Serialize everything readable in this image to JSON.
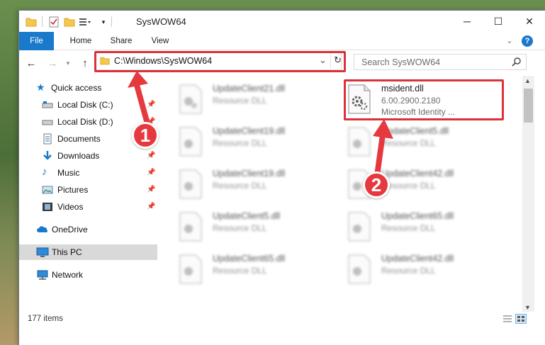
{
  "window": {
    "title": "SysWOW64",
    "minimize_glyph": "─",
    "maximize_glyph": "☐",
    "close_glyph": "✕"
  },
  "ribbon": {
    "tabs": [
      {
        "label": "File"
      },
      {
        "label": "Home"
      },
      {
        "label": "Share"
      },
      {
        "label": "View"
      }
    ],
    "expand_glyph": "⌄",
    "help_glyph": "?"
  },
  "address": {
    "path": "C:\\Windows\\SysWOW64",
    "dropdown_glyph": "⌄",
    "refresh_glyph": "↻"
  },
  "search": {
    "placeholder": "Search SysWOW64"
  },
  "nav": {
    "items": [
      {
        "label": "Quick access",
        "icon": "star-icon"
      },
      {
        "label": "Local Disk (C:)",
        "icon": "drive-icon",
        "pinned": true
      },
      {
        "label": "Local Disk (D:)",
        "icon": "drive-icon",
        "pinned": true
      },
      {
        "label": "Documents",
        "icon": "documents-icon",
        "pinned": true
      },
      {
        "label": "Downloads",
        "icon": "download-icon",
        "pinned": true
      },
      {
        "label": "Music",
        "icon": "music-icon",
        "pinned": true
      },
      {
        "label": "Pictures",
        "icon": "pictures-icon",
        "pinned": true
      },
      {
        "label": "Videos",
        "icon": "videos-icon",
        "pinned": true
      },
      {
        "label": "OneDrive",
        "icon": "cloud-icon"
      },
      {
        "label": "This PC",
        "icon": "computer-icon",
        "selected": true
      },
      {
        "label": "Network",
        "icon": "network-icon"
      }
    ]
  },
  "files": [
    {
      "name": "UpdateClient21.dll",
      "sub1": "Resource DLL",
      "blurred": true
    },
    {
      "name": "msident.dll",
      "sub1": "6.00.2900.2180",
      "sub2": "Microsoft Identity ...",
      "blurred": false
    },
    {
      "name": "UpdateClient19.dll",
      "sub1": "Resource DLL",
      "blurred": true
    },
    {
      "name": "UpdateClient5.dll",
      "sub1": "Resource DLL",
      "blurred": true
    },
    {
      "name": "UpdateClient19.dll",
      "sub1": "Resource DLL",
      "blurred": true
    },
    {
      "name": "UpdateClient42.dll",
      "sub1": "Resource DLL",
      "blurred": true
    },
    {
      "name": "UpdateClient5.dll",
      "sub1": "Resource DLL",
      "blurred": true
    },
    {
      "name": "UpdateClient65.dll",
      "sub1": "Resource DLL",
      "blurred": true
    },
    {
      "name": "UpdateClient65.dll",
      "sub1": "Resource DLL",
      "blurred": true
    },
    {
      "name": "UpdateClient42.dll",
      "sub1": "Resource DLL",
      "blurred": true
    }
  ],
  "status": {
    "item_count": "177 items"
  },
  "annotations": {
    "marker1": "1",
    "marker2": "2"
  },
  "colors": {
    "accent": "#1979ca",
    "highlight": "#d9323a"
  }
}
